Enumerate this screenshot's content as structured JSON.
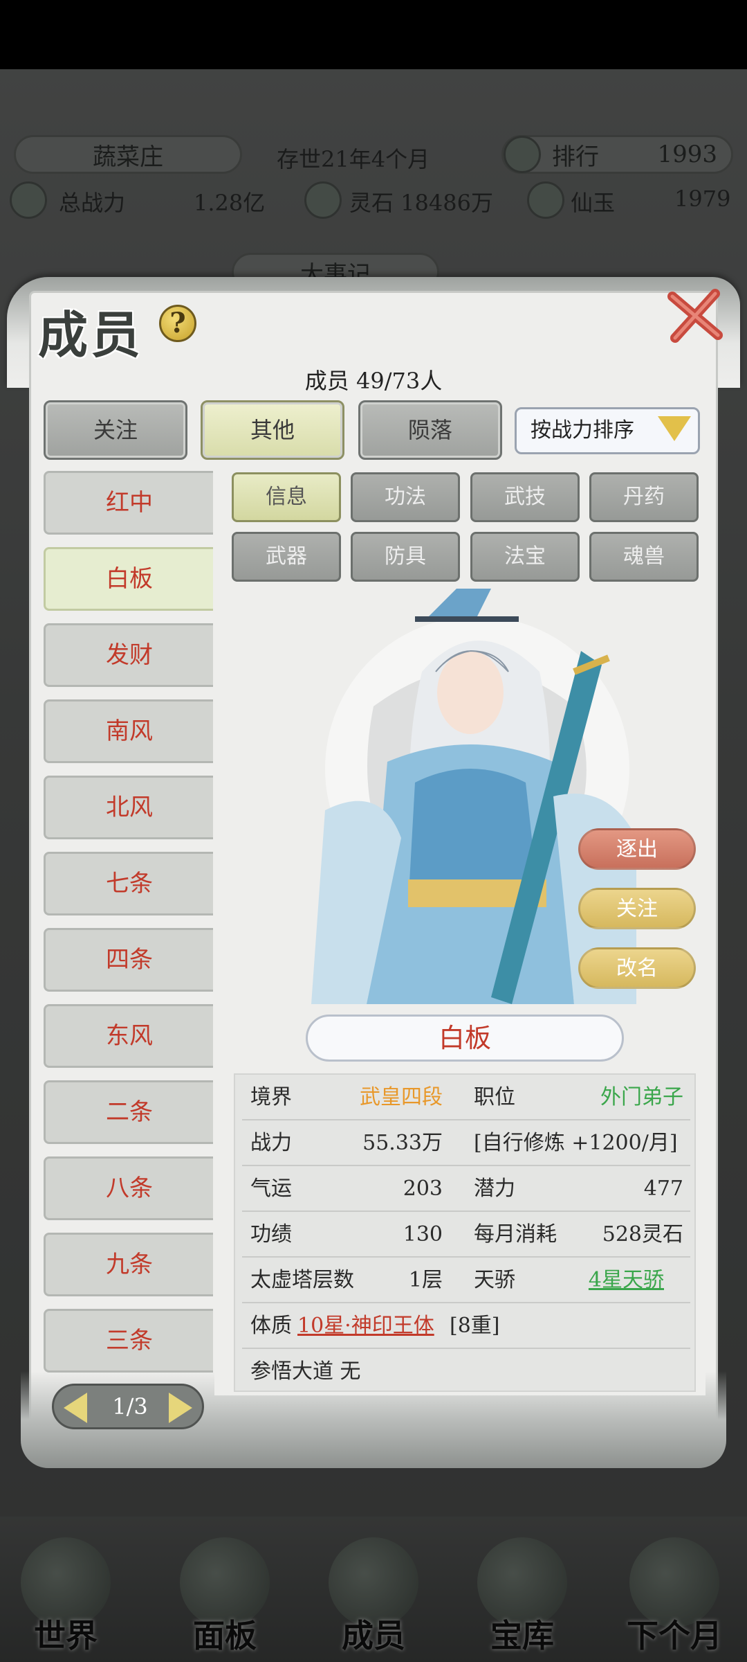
{
  "hud": {
    "farm_name": "蔬菜庄",
    "age_text": "存世21年4个月",
    "rank_label": "排行",
    "rank_value": "1993",
    "power_label": "总战力",
    "power_value": "1.28亿",
    "spirit_stone": "灵石 18486万",
    "immortal_jade_label": "仙玉",
    "immortal_jade_value": "1979",
    "chronicle": "大事记"
  },
  "modal": {
    "title": "成员",
    "member_count": "成员 49/73人",
    "tabs": [
      "关注",
      "其他",
      "陨落"
    ],
    "sort_label": "按战力排序"
  },
  "members": [
    "红中",
    "白板",
    "发财",
    "南风",
    "北风",
    "七条",
    "四条",
    "东风",
    "二条",
    "八条",
    "九条",
    "三条"
  ],
  "subtabs": [
    "信息",
    "功法",
    "武技",
    "丹药",
    "武器",
    "防具",
    "法宝",
    "魂兽"
  ],
  "actions": {
    "expel": "逐出",
    "follow": "关注",
    "rename": "改名"
  },
  "character": {
    "name": "白板"
  },
  "stats": {
    "realm_label": "境界",
    "realm_value": "武皇四段",
    "position_label": "职位",
    "position_value": "外门弟子",
    "power_label": "战力",
    "power_value": "55.33万",
    "training_text": "[自行修炼 +1200/月]",
    "luck_label": "气运",
    "luck_value": "203",
    "potential_label": "潜力",
    "potential_value": "477",
    "merit_label": "功绩",
    "merit_value": "130",
    "cost_label": "每月消耗",
    "cost_value": "528灵石",
    "tower_label": "太虚塔层数",
    "tower_value": "1层",
    "talent_label": "天骄",
    "talent_value": "4星天骄",
    "physique_label": "体质",
    "physique_value": "10星·神印王体",
    "physique_level": "[8重]",
    "dao_text": "参悟大道 无"
  },
  "pager": {
    "text": "1/3"
  },
  "bottom_nav": [
    "世界",
    "面板",
    "成员",
    "宝库",
    "下个月"
  ],
  "colors": {
    "accent_red": "#c23a2a",
    "gold": "#e8982a",
    "green": "#3aa64b"
  }
}
